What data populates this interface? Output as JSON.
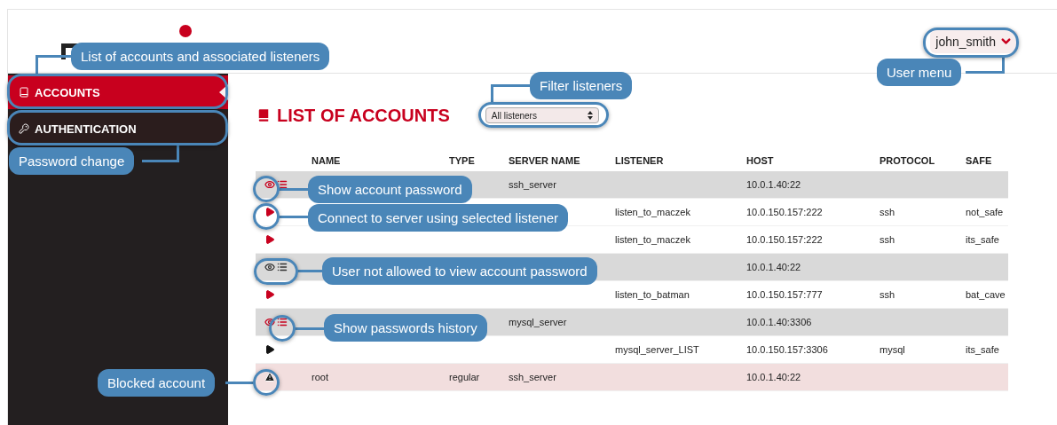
{
  "header": {
    "user_menu": {
      "label": "john_smith"
    }
  },
  "sidebar": {
    "items": [
      {
        "label": "ACCOUNTS",
        "selected": true
      },
      {
        "label": "AUTHENTICATION",
        "selected": false
      }
    ]
  },
  "main": {
    "title": "LIST OF ACCOUNTS",
    "filter": {
      "value": "All listeners"
    },
    "table": {
      "columns": [
        "NAME",
        "TYPE",
        "SERVER NAME",
        "LISTENER",
        "HOST",
        "PROTOCOL",
        "SAFE"
      ],
      "rows": [
        {
          "kind": "account",
          "password_viewable": true,
          "server_name": "ssh_server",
          "host": "10.0.1.40:22"
        },
        {
          "kind": "listener",
          "enabled": true,
          "listener": "listen_to_maczek",
          "host": "10.0.150.157:222",
          "protocol": "ssh",
          "safe": "not_safe"
        },
        {
          "kind": "listener",
          "enabled": true,
          "listener": "listen_to_maczek",
          "host": "10.0.150.157:222",
          "protocol": "ssh",
          "safe": "its_safe"
        },
        {
          "kind": "account",
          "password_viewable": false,
          "host": "10.0.1.40:22"
        },
        {
          "kind": "listener",
          "enabled": true,
          "listener": "listen_to_batman",
          "host": "10.0.150.157:777",
          "protocol": "ssh",
          "safe": "bat_cave"
        },
        {
          "kind": "account",
          "password_viewable": true,
          "server_name": "mysql_server",
          "host": "10.0.1.40:3306"
        },
        {
          "kind": "listener",
          "enabled": false,
          "listener": "mysql_server_LIST",
          "host": "10.0.150.157:3306",
          "protocol": "mysql",
          "safe": "its_safe"
        },
        {
          "kind": "blocked",
          "name": "root",
          "type": "regular",
          "server_name": "ssh_server",
          "host": "10.0.1.40:22"
        }
      ]
    }
  },
  "callouts": [
    {
      "text": "List of accounts and associated listeners"
    },
    {
      "text": "Password change"
    },
    {
      "text": "User menu"
    },
    {
      "text": "Filter listeners"
    },
    {
      "text": "Show account password"
    },
    {
      "text": "Connect to server using selected listener"
    },
    {
      "text": "User not allowed to view account password"
    },
    {
      "text": "Show passwords history"
    },
    {
      "text": "Blocked account"
    }
  ]
}
